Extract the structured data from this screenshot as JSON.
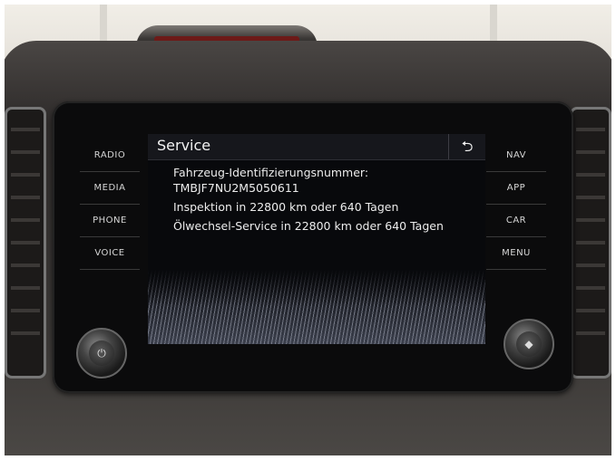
{
  "screen": {
    "title": "Service",
    "back_icon": "back-arrow-icon",
    "lines": [
      "Fahrzeug-Identifizierungsnummer:",
      "TMBJF7NU2M5050611",
      "Inspektion in 22800 km oder 640 Tagen",
      "Ölwechsel-Service in 22800 km oder 640 Tagen"
    ]
  },
  "left_buttons": [
    "RADIO",
    "MEDIA",
    "PHONE",
    "VOICE"
  ],
  "right_buttons": [
    "NAV",
    "APP",
    "CAR",
    "MENU"
  ],
  "colors": {
    "screen_bg": "#08090c",
    "header_bg": "#16171c",
    "text": "#ececec",
    "button_text": "#d6d6d6"
  }
}
